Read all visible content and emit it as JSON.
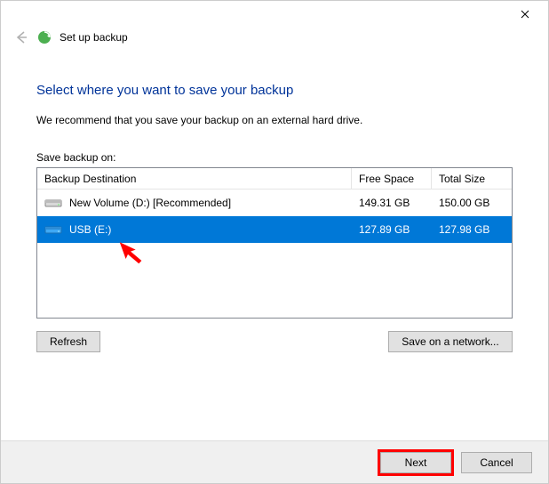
{
  "window": {
    "wizard_title": "Set up backup"
  },
  "page": {
    "heading": "Select where you want to save your backup",
    "recommendation": "We recommend that you save your backup on an external hard drive.",
    "save_label": "Save backup on:"
  },
  "table": {
    "columns": {
      "destination": "Backup Destination",
      "free": "Free Space",
      "total": "Total Size"
    },
    "rows": [
      {
        "icon": "hdd",
        "name": "New Volume (D:) [Recommended]",
        "free": "149.31 GB",
        "total": "150.00 GB",
        "selected": false
      },
      {
        "icon": "usb",
        "name": "USB (E:)",
        "free": "127.89 GB",
        "total": "127.98 GB",
        "selected": true
      }
    ]
  },
  "buttons": {
    "refresh": "Refresh",
    "network": "Save on a network...",
    "next": "Next",
    "cancel": "Cancel"
  },
  "colors": {
    "selection": "#0078d7",
    "heading": "#003399",
    "highlight": "#ff0000"
  }
}
